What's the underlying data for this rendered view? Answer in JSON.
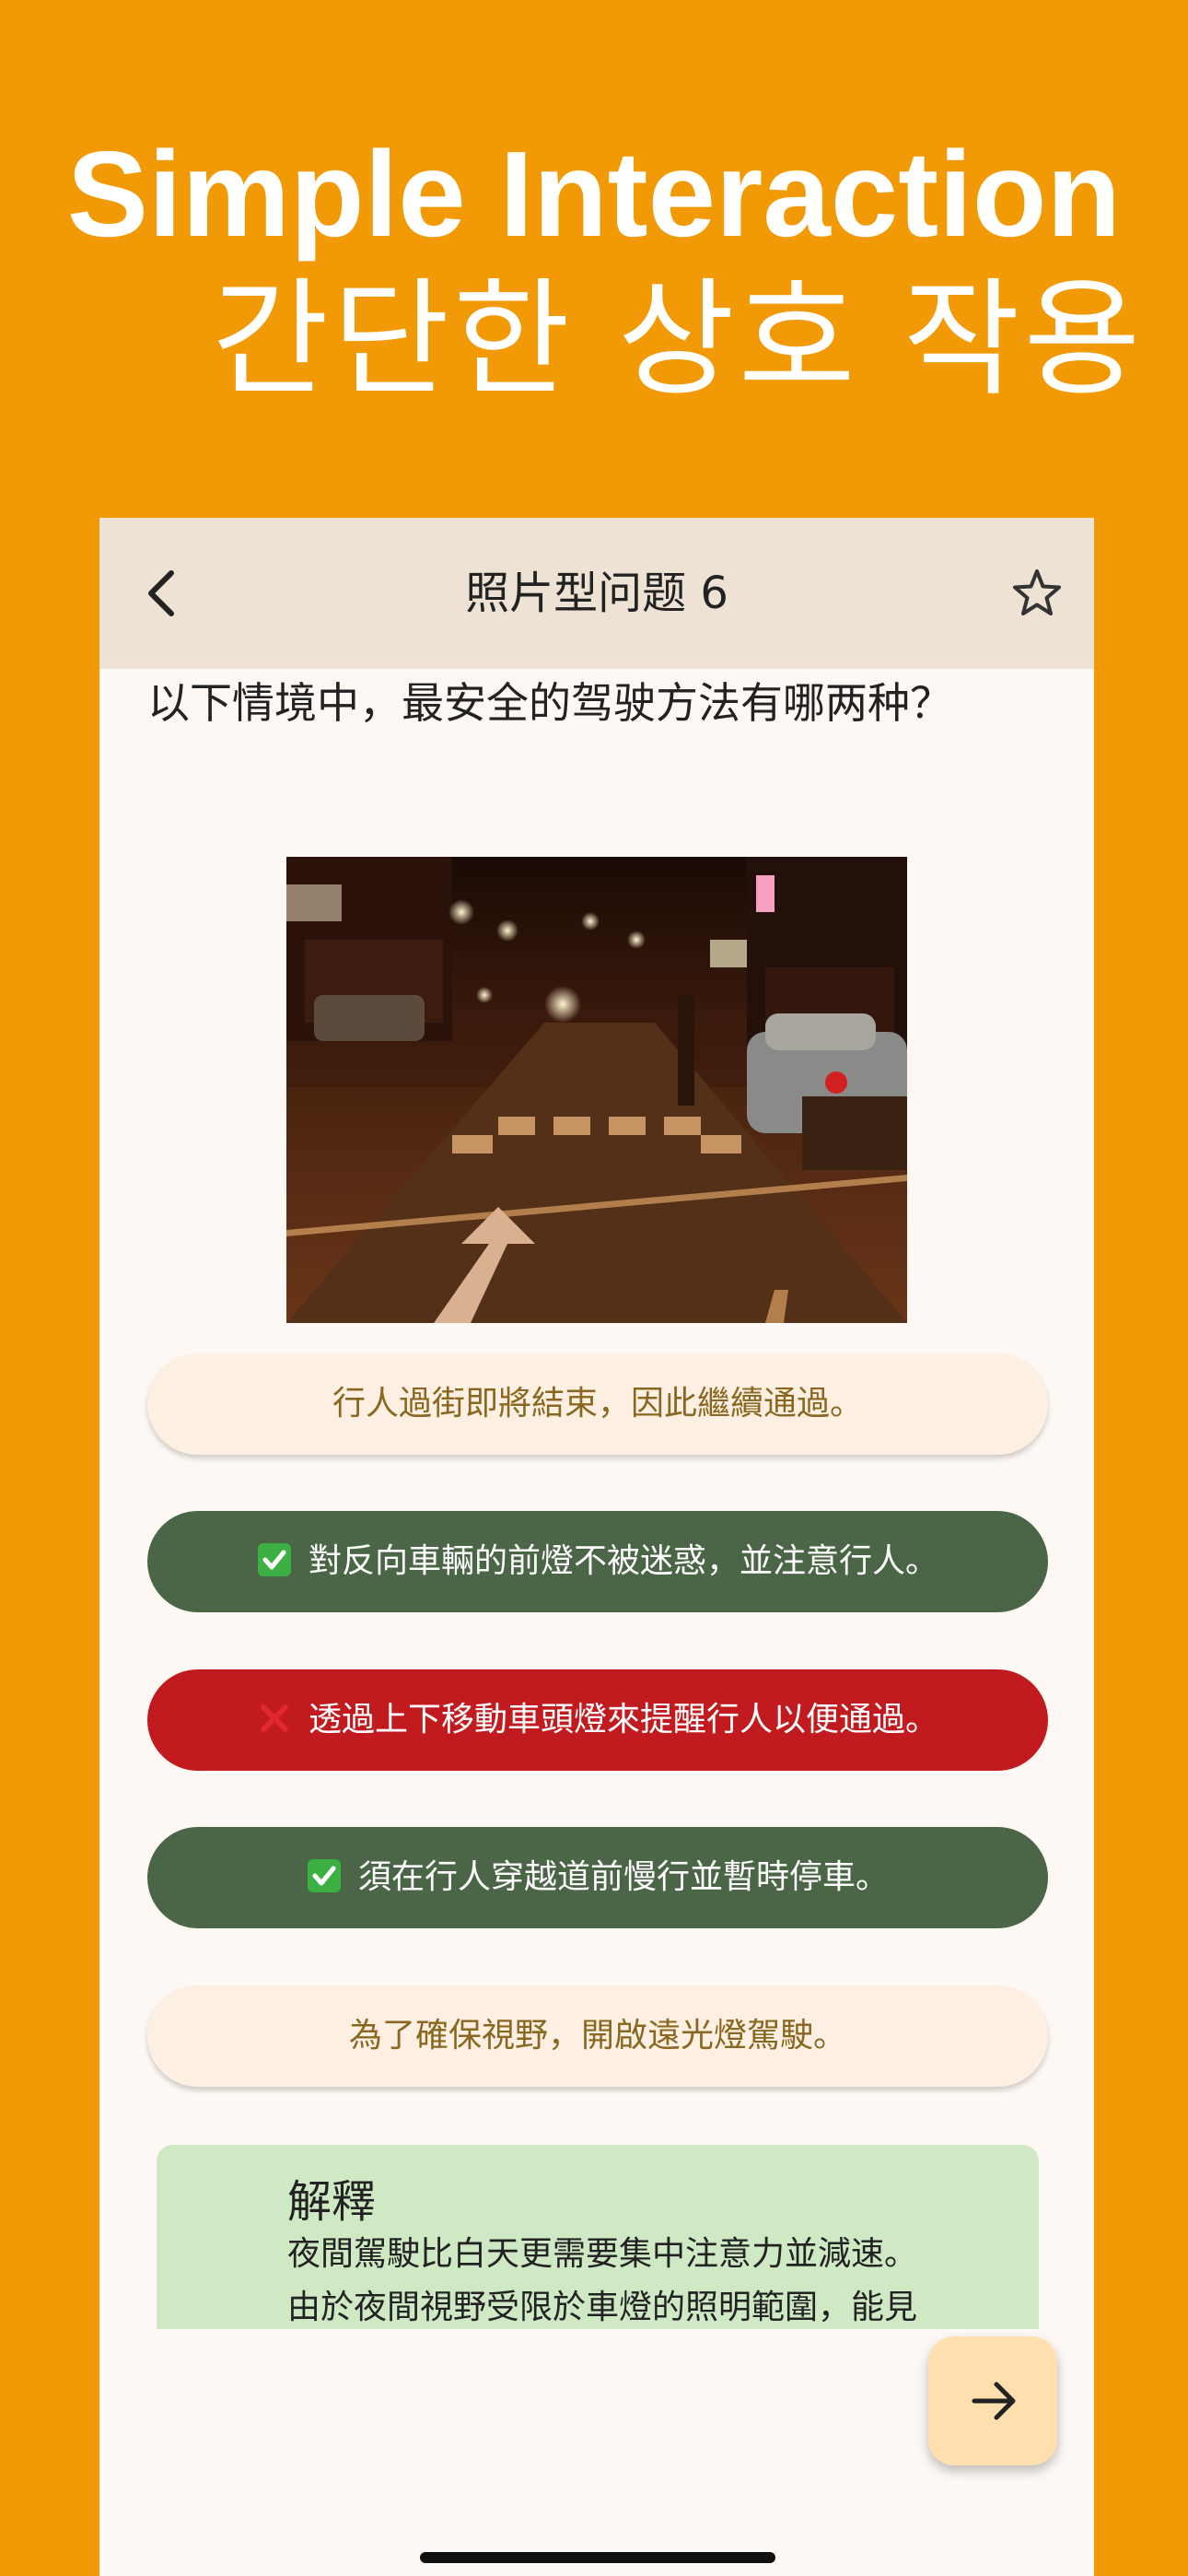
{
  "hero": {
    "title_en": "Simple Interaction",
    "title_ko": "간단한 상호 작용"
  },
  "appbar": {
    "title": "照片型问题 6",
    "back_icon": "chevron-left-icon",
    "star_icon": "star-outline-icon"
  },
  "question": {
    "text": "以下情境中，最安全的驾驶方法有哪两种？"
  },
  "photo": {
    "description_icon": "night-street-photo"
  },
  "options": [
    {
      "label": "行人過街即將結束，因此繼續通過。",
      "state": "neutral",
      "mark": ""
    },
    {
      "label": "對反向車輛的前燈不被迷惑，並注意行人。",
      "state": "correct",
      "mark": "check-icon"
    },
    {
      "label": "透過上下移動車頭燈來提醒行人以便通過。",
      "state": "wrong",
      "mark": "cross-icon"
    },
    {
      "label": "須在行人穿越道前慢行並暫時停車。",
      "state": "correct",
      "mark": "check-icon"
    },
    {
      "label": "為了確保視野，開啟遠光燈駕駛。",
      "state": "neutral",
      "mark": ""
    }
  ],
  "explanation": {
    "title": "解釋",
    "line1": "夜間駕駛比白天更需要集中注意力並減速。",
    "line2": "由於夜間視野受限於車燈的照明範圍，能見"
  },
  "fab": {
    "icon": "arrow-right-icon"
  },
  "colors": {
    "background": "#F29A06",
    "appbar": "#EDE2D4",
    "correct": "#4B6646",
    "wrong": "#C11B1F",
    "neutral": "#FDF0E2",
    "explanation": "#CFE9C4",
    "fab": "#FFDFAE"
  }
}
